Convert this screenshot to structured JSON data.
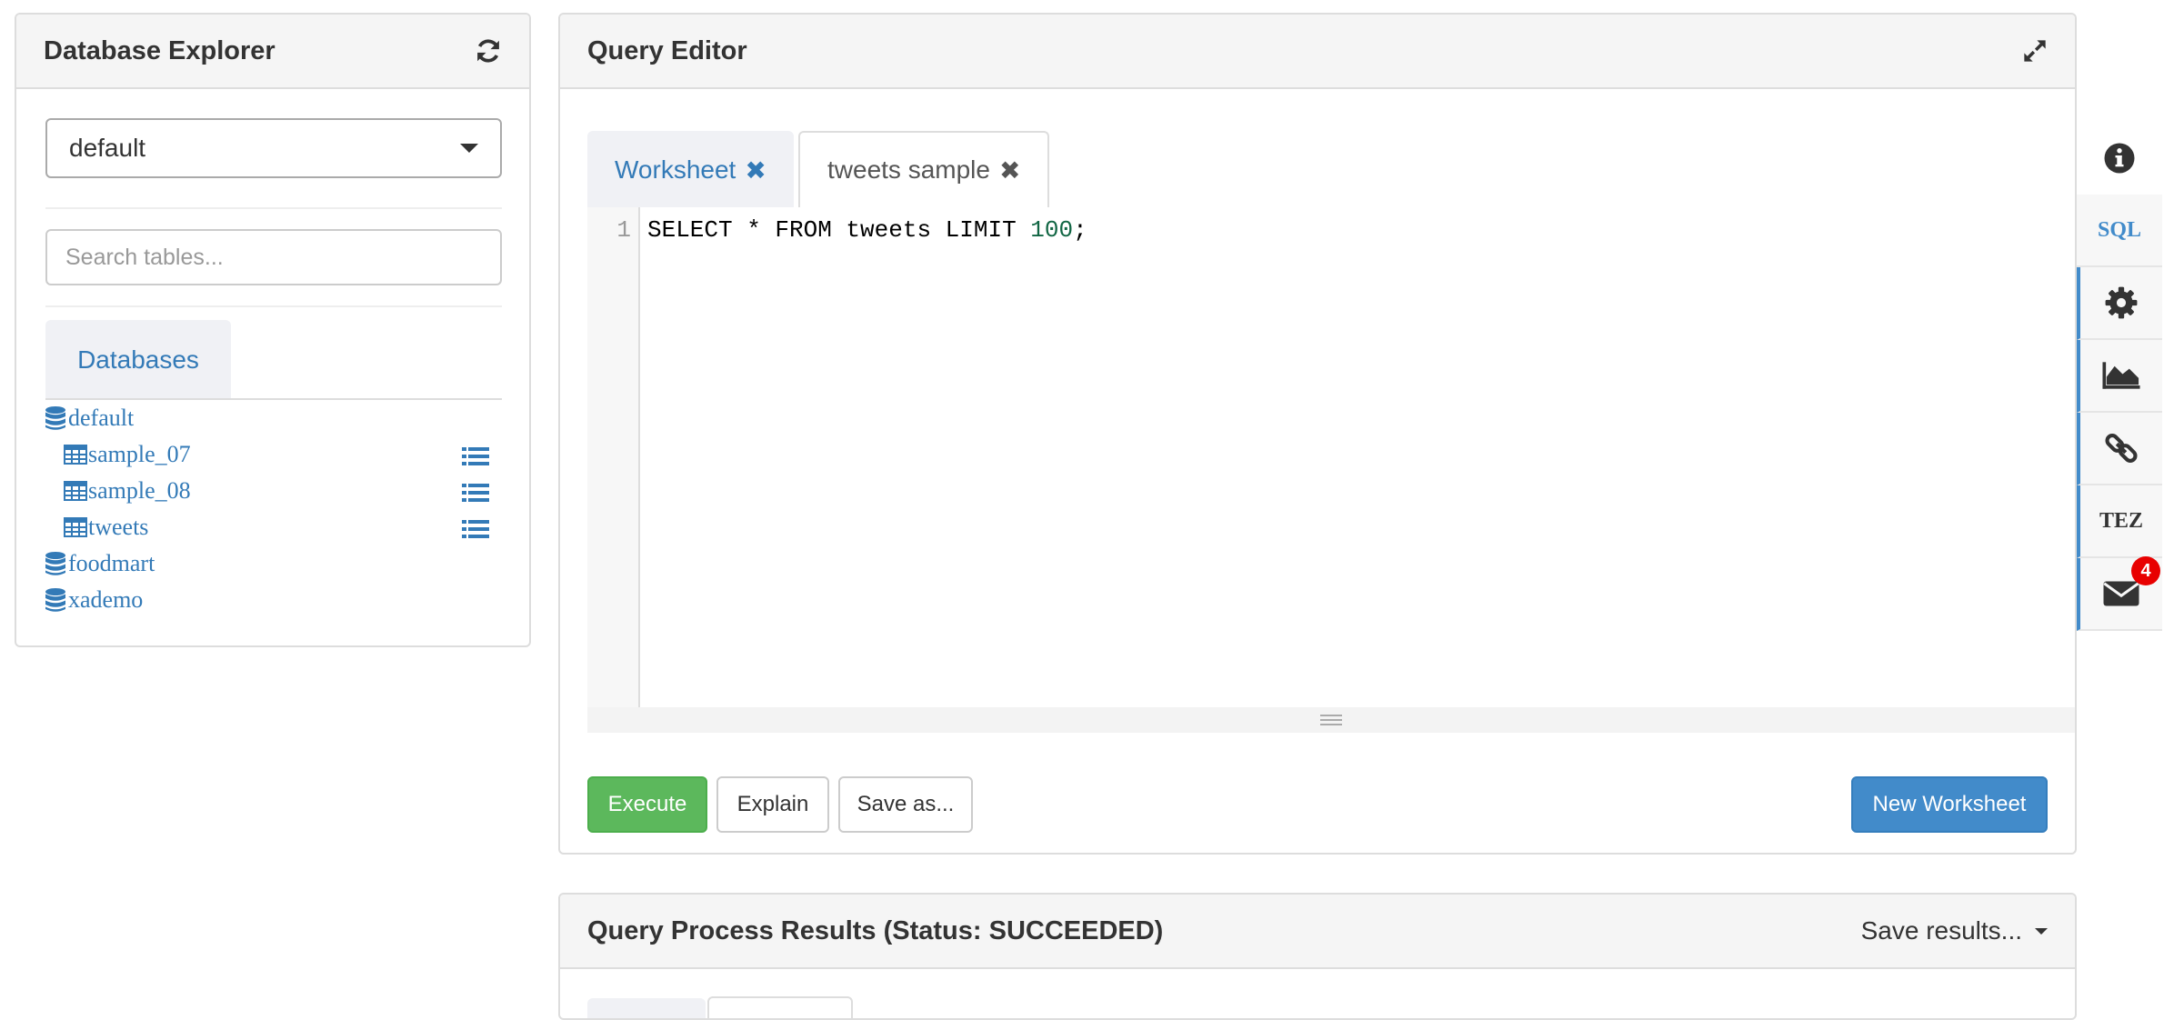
{
  "database_explorer": {
    "title": "Database Explorer",
    "refresh_icon": "refresh-icon",
    "selected_database": "default",
    "search": {
      "placeholder": "Search tables...",
      "value": ""
    },
    "tab_label": "Databases",
    "tree": [
      {
        "type": "database",
        "name": "default",
        "expanded": true,
        "tables": [
          {
            "name": "sample_07"
          },
          {
            "name": "sample_08"
          },
          {
            "name": "tweets"
          }
        ]
      },
      {
        "type": "database",
        "name": "foodmart"
      },
      {
        "type": "database",
        "name": "xademo"
      }
    ]
  },
  "query_editor": {
    "title": "Query Editor",
    "expand_icon": "expand-icon",
    "tabs": [
      {
        "label": "Worksheet",
        "close": "✖",
        "active": false
      },
      {
        "label": "tweets sample",
        "close": "✖",
        "active": true
      }
    ],
    "editor": {
      "line_number": "1",
      "code_prefix": "SELECT * FROM tweets LIMIT ",
      "code_number": "100",
      "code_suffix": ";"
    },
    "buttons": {
      "execute": "Execute",
      "explain": "Explain",
      "save_as": "Save as...",
      "new_worksheet": "New Worksheet"
    }
  },
  "sidebar": {
    "items": [
      {
        "icon": "info-icon"
      },
      {
        "text": "SQL",
        "color": "#428bca"
      },
      {
        "icon": "gear-icon"
      },
      {
        "icon": "area-chart-icon"
      },
      {
        "icon": "link-icon"
      },
      {
        "text": "TEZ",
        "color": "#333333"
      },
      {
        "icon": "envelope-icon",
        "badge": "4"
      }
    ]
  },
  "results": {
    "title": "Query Process Results (Status: SUCCEEDED)",
    "save_results": "Save results..."
  },
  "colors": {
    "link": "#337ab7",
    "success": "#5cb85c",
    "primary": "#428bca",
    "badge": "#e80000",
    "code_number": "#116644"
  }
}
